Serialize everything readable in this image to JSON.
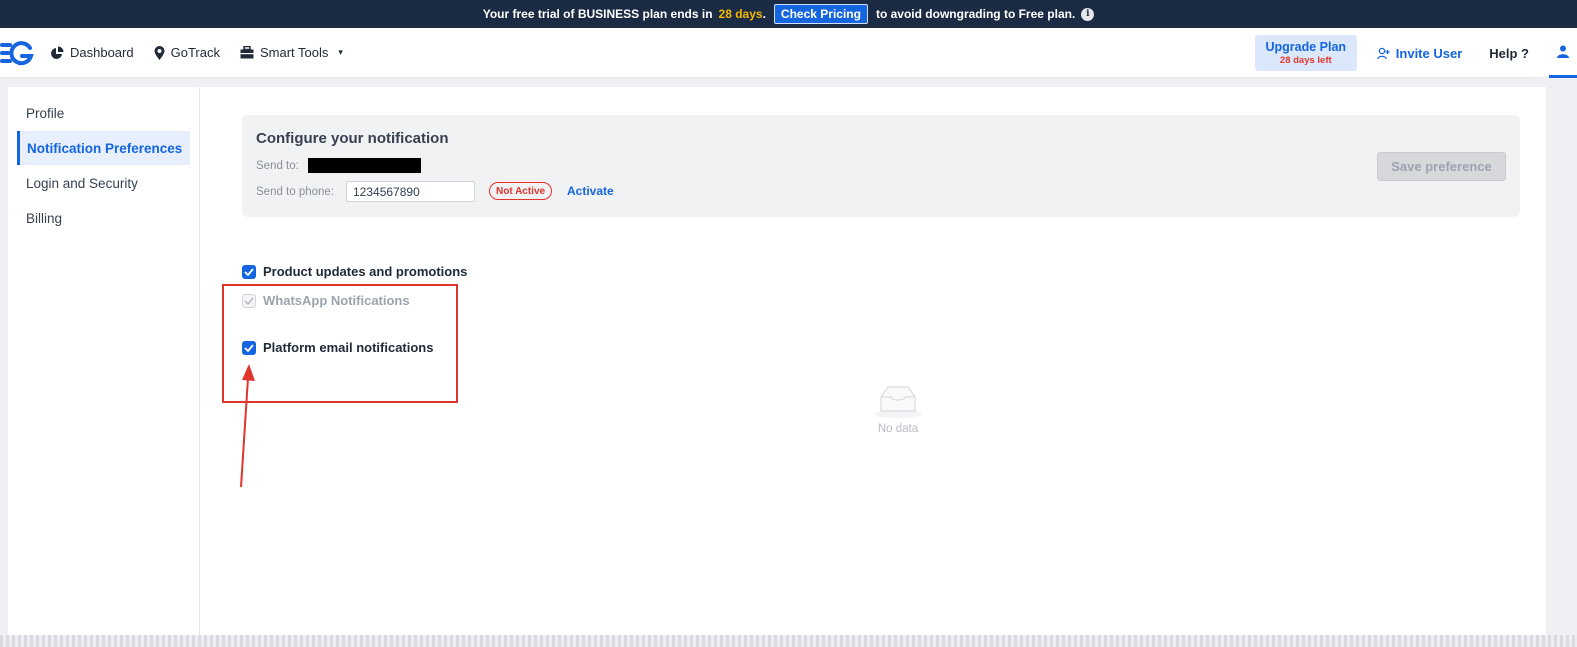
{
  "banner": {
    "text_before": "Your free trial of BUSINESS plan ends in",
    "days": "28 days",
    "after_days": ".",
    "pricing_button": "Check Pricing",
    "text_after": "to avoid downgrading to Free plan.",
    "info_icon_label": "i"
  },
  "nav": {
    "items": [
      {
        "label": "Dashboard",
        "icon": "pie-chart-icon"
      },
      {
        "label": "GoTrack",
        "icon": "map-pin-icon"
      },
      {
        "label": "Smart Tools",
        "icon": "toolbox-icon",
        "caret": "▾"
      }
    ],
    "upgrade": {
      "title": "Upgrade Plan",
      "subtitle": "28 days left"
    },
    "invite": "Invite User",
    "help": "Help ?"
  },
  "sidebar": {
    "items": [
      {
        "label": "Profile",
        "active": false
      },
      {
        "label": "Notification Preferences",
        "active": true
      },
      {
        "label": "Login and Security",
        "active": false
      },
      {
        "label": "Billing",
        "active": false
      }
    ]
  },
  "config": {
    "title": "Configure your notification",
    "send_to_label": "Send to:",
    "send_to_phone_label": "Send to phone:",
    "phone_value": "1234567890",
    "status_badge": "Not Active",
    "activate_link": "Activate",
    "save_button": "Save preference"
  },
  "options": [
    {
      "label": "Product updates and promotions",
      "checked": true,
      "disabled": false
    },
    {
      "label": "WhatsApp Notifications",
      "checked": true,
      "disabled": true
    },
    {
      "label": "Platform email notifications",
      "checked": true,
      "disabled": false
    }
  ],
  "empty_state": {
    "text": "No data"
  },
  "colors": {
    "brand_blue": "#1565e0",
    "banner_bg": "#1b2b44",
    "warning_yellow": "#f5b800",
    "alert_red": "#e0352b"
  }
}
